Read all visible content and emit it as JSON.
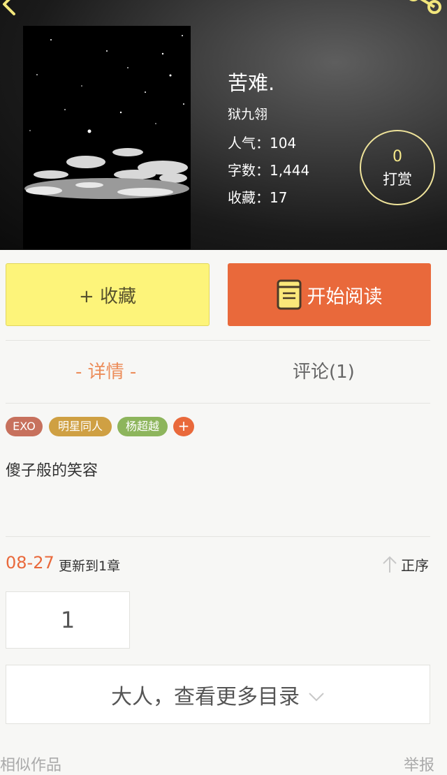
{
  "book": {
    "title": "苦难.",
    "author": "狱九翎",
    "popularity": "人气：104",
    "word_count": "字数：1,444",
    "favorites": "收藏：17"
  },
  "tip": {
    "count": "0",
    "label": "打赏"
  },
  "actions": {
    "collect_label": "+ 收藏",
    "read_label": "开始阅读"
  },
  "tabs": {
    "detail": "- 详情 -",
    "comments": "评论(1)"
  },
  "tags": [
    {
      "label": "EXO",
      "color": "#c7715d"
    },
    {
      "label": "明星同人",
      "color": "#cfa043"
    },
    {
      "label": "杨超越",
      "color": "#8db55c"
    }
  ],
  "tag_add_label": "+",
  "description": "傻子般的笑容",
  "update": {
    "date": "08-27",
    "text": "更新到1章",
    "sort_label": "正序"
  },
  "chapters": [
    "1"
  ],
  "more_catalog_label": "大人，查看更多目录",
  "footer": {
    "similar_works": "相似作品",
    "report": "举报"
  },
  "colors": {
    "accent": "#e9693b",
    "collect_bg": "#fdf47a",
    "tab_active": "#ec8d5a"
  },
  "icons": {
    "back": "chevron-left-icon",
    "share": "share-icon",
    "read": "book-icon",
    "sort": "arrow-up-icon",
    "more": "chevron-down-icon"
  }
}
